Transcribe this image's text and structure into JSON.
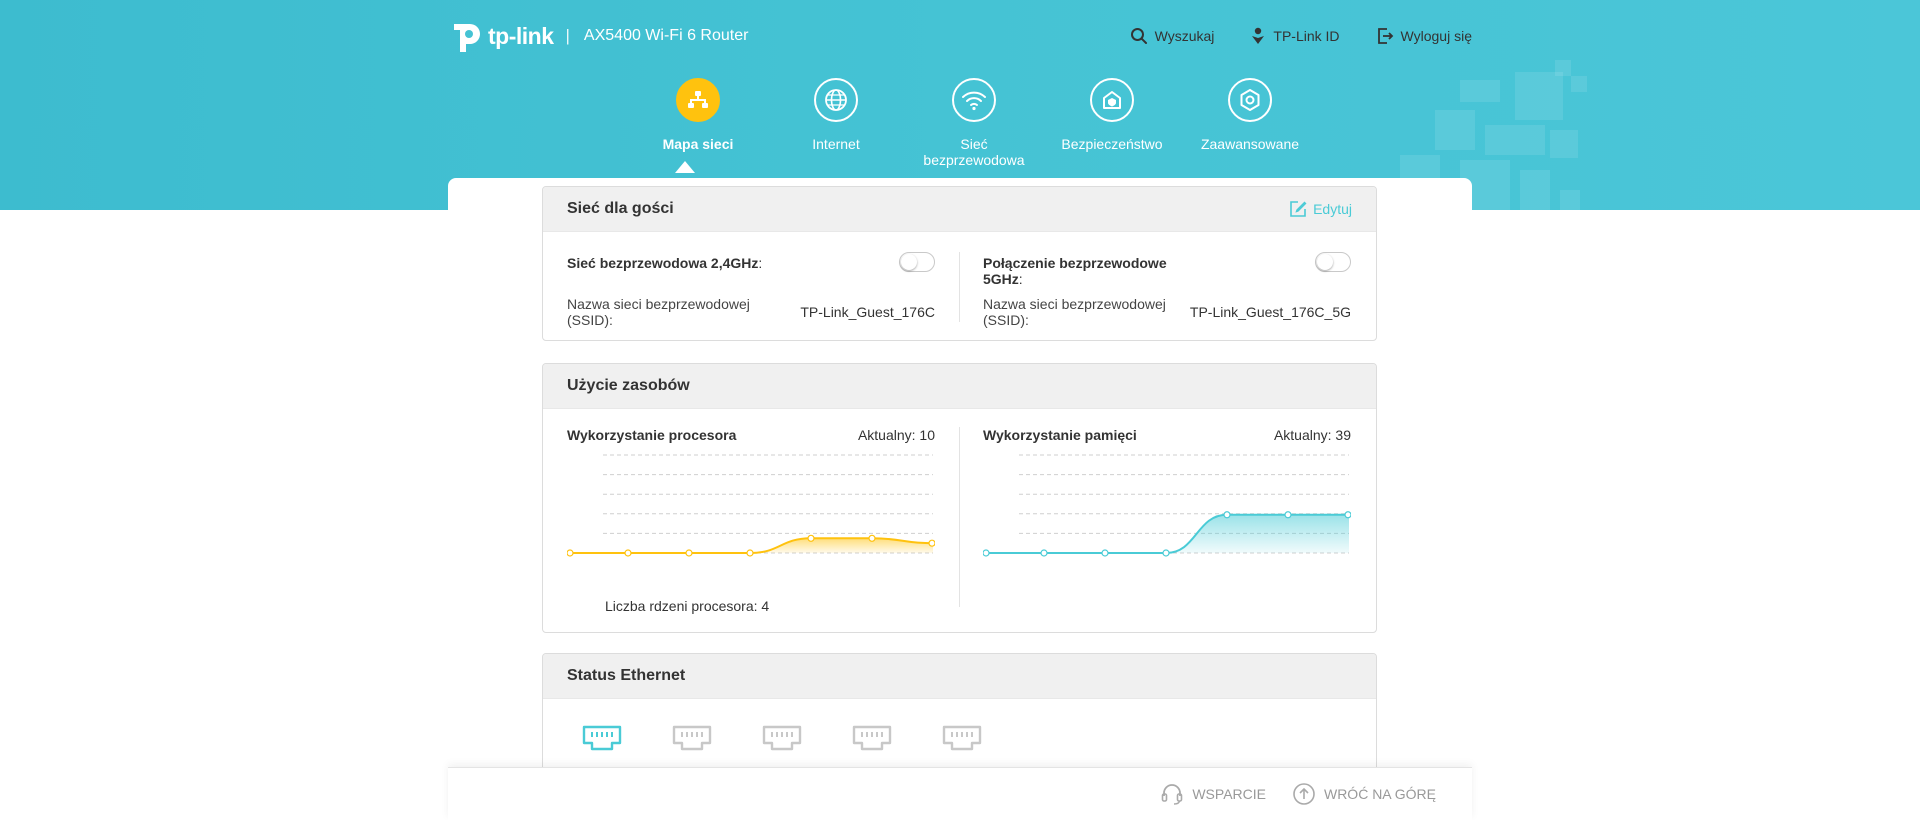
{
  "header": {
    "logo_text": "tp-link",
    "separator": "|",
    "model": "AX5400 Wi-Fi 6 Router",
    "actions": [
      {
        "label": "Wyszukaj",
        "icon": "search-icon"
      },
      {
        "label": "TP-Link ID",
        "icon": "user-id-icon"
      },
      {
        "label": "Wyloguj się",
        "icon": "logout-icon"
      }
    ]
  },
  "nav": {
    "items": [
      {
        "label": "Mapa sieci",
        "icon": "network-map-icon",
        "active": true
      },
      {
        "label": "Internet",
        "icon": "globe-icon",
        "active": false
      },
      {
        "label": "Sieć bezprzewodowa",
        "icon": "wifi-icon",
        "active": false
      },
      {
        "label": "Bezpieczeństwo",
        "icon": "shield-home-icon",
        "active": false
      },
      {
        "label": "Zaawansowane",
        "icon": "gear-icon",
        "active": false
      }
    ]
  },
  "guest": {
    "title": "Sieć dla gości",
    "edit": "Edytuj",
    "band24": {
      "label": "Sieć bezprzewodowa 2,4GHz",
      "colon": ":",
      "enabled": false,
      "ssid_label": "Nazwa sieci bezprzewodowej (SSID):",
      "ssid": "TP-Link_Guest_176C"
    },
    "band5": {
      "label": "Połączenie bezprzewodowe 5GHz",
      "colon": ":",
      "enabled": false,
      "ssid_label": "Nazwa sieci bezprzewodowej (SSID):",
      "ssid": "TP-Link_Guest_176C_5G"
    }
  },
  "resources": {
    "title": "Użycie zasobów",
    "cpu": {
      "label": "Wykorzystanie procesora",
      "current": "Aktualny: 10",
      "cores": "Liczba rdzeni procesora: 4"
    },
    "mem": {
      "label": "Wykorzystanie pamięci",
      "current": "Aktualny: 39"
    }
  },
  "chart_data": [
    {
      "type": "area",
      "name_key": "cpu",
      "ylim": [
        0,
        100
      ],
      "grid": true,
      "values": [
        0,
        0,
        0,
        0,
        15,
        15,
        10
      ],
      "color": "#ffc20e"
    },
    {
      "type": "area",
      "name_key": "mem",
      "ylim": [
        0,
        100
      ],
      "grid": true,
      "values": [
        0,
        0,
        0,
        0,
        39,
        39,
        39
      ],
      "color": "#4acbd6"
    }
  ],
  "ethernet": {
    "title": "Status Ethernet",
    "ports": [
      {
        "connected": true
      },
      {
        "connected": false
      },
      {
        "connected": false
      },
      {
        "connected": false
      },
      {
        "connected": false
      }
    ]
  },
  "footer": {
    "support": "WSPARCIE",
    "back_to_top": "WRÓĆ NA GÓRĘ"
  },
  "colors": {
    "banner": "#45c3d4",
    "active_nav": "#ffc20e",
    "accent": "#4acbd6"
  }
}
